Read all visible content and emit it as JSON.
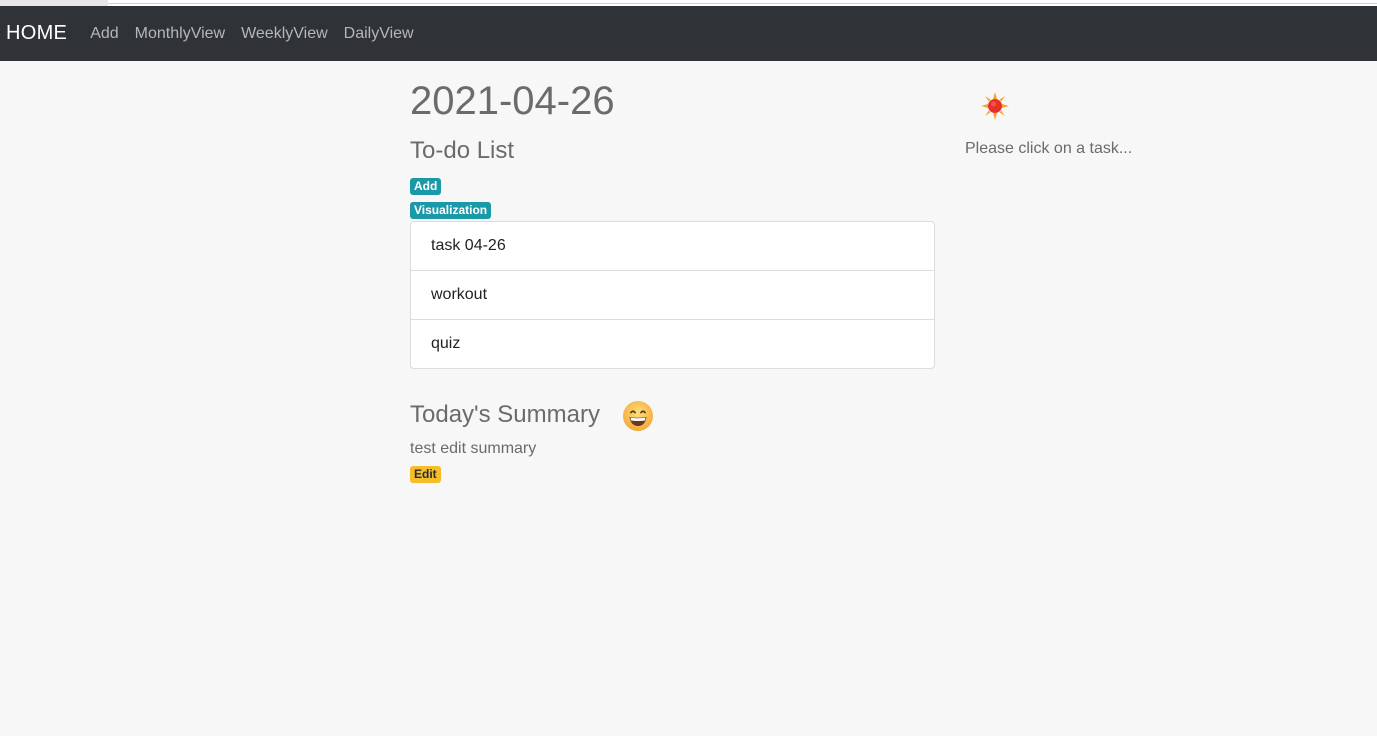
{
  "nav": {
    "brand": "HOME",
    "links": [
      "Add",
      "MonthlyView",
      "WeeklyView",
      "DailyView"
    ]
  },
  "main": {
    "date": "2021-04-26",
    "todo_heading": "To-do List",
    "add_label": "Add",
    "visualization_label": "Visualization",
    "tasks": [
      "task 04-26",
      "workout",
      "quiz"
    ],
    "summary_heading": "Today's Summary",
    "summary_icon": "grinning-face-icon",
    "summary_text": "test edit summary",
    "edit_label": "Edit"
  },
  "side": {
    "weather_icon": "sun-icon",
    "hint": "Please click on a task..."
  },
  "colors": {
    "navbar": "#2f3237",
    "info_badge": "#1a9aa8",
    "warning_badge": "#f6bd2b",
    "background": "#f7f7f7"
  }
}
